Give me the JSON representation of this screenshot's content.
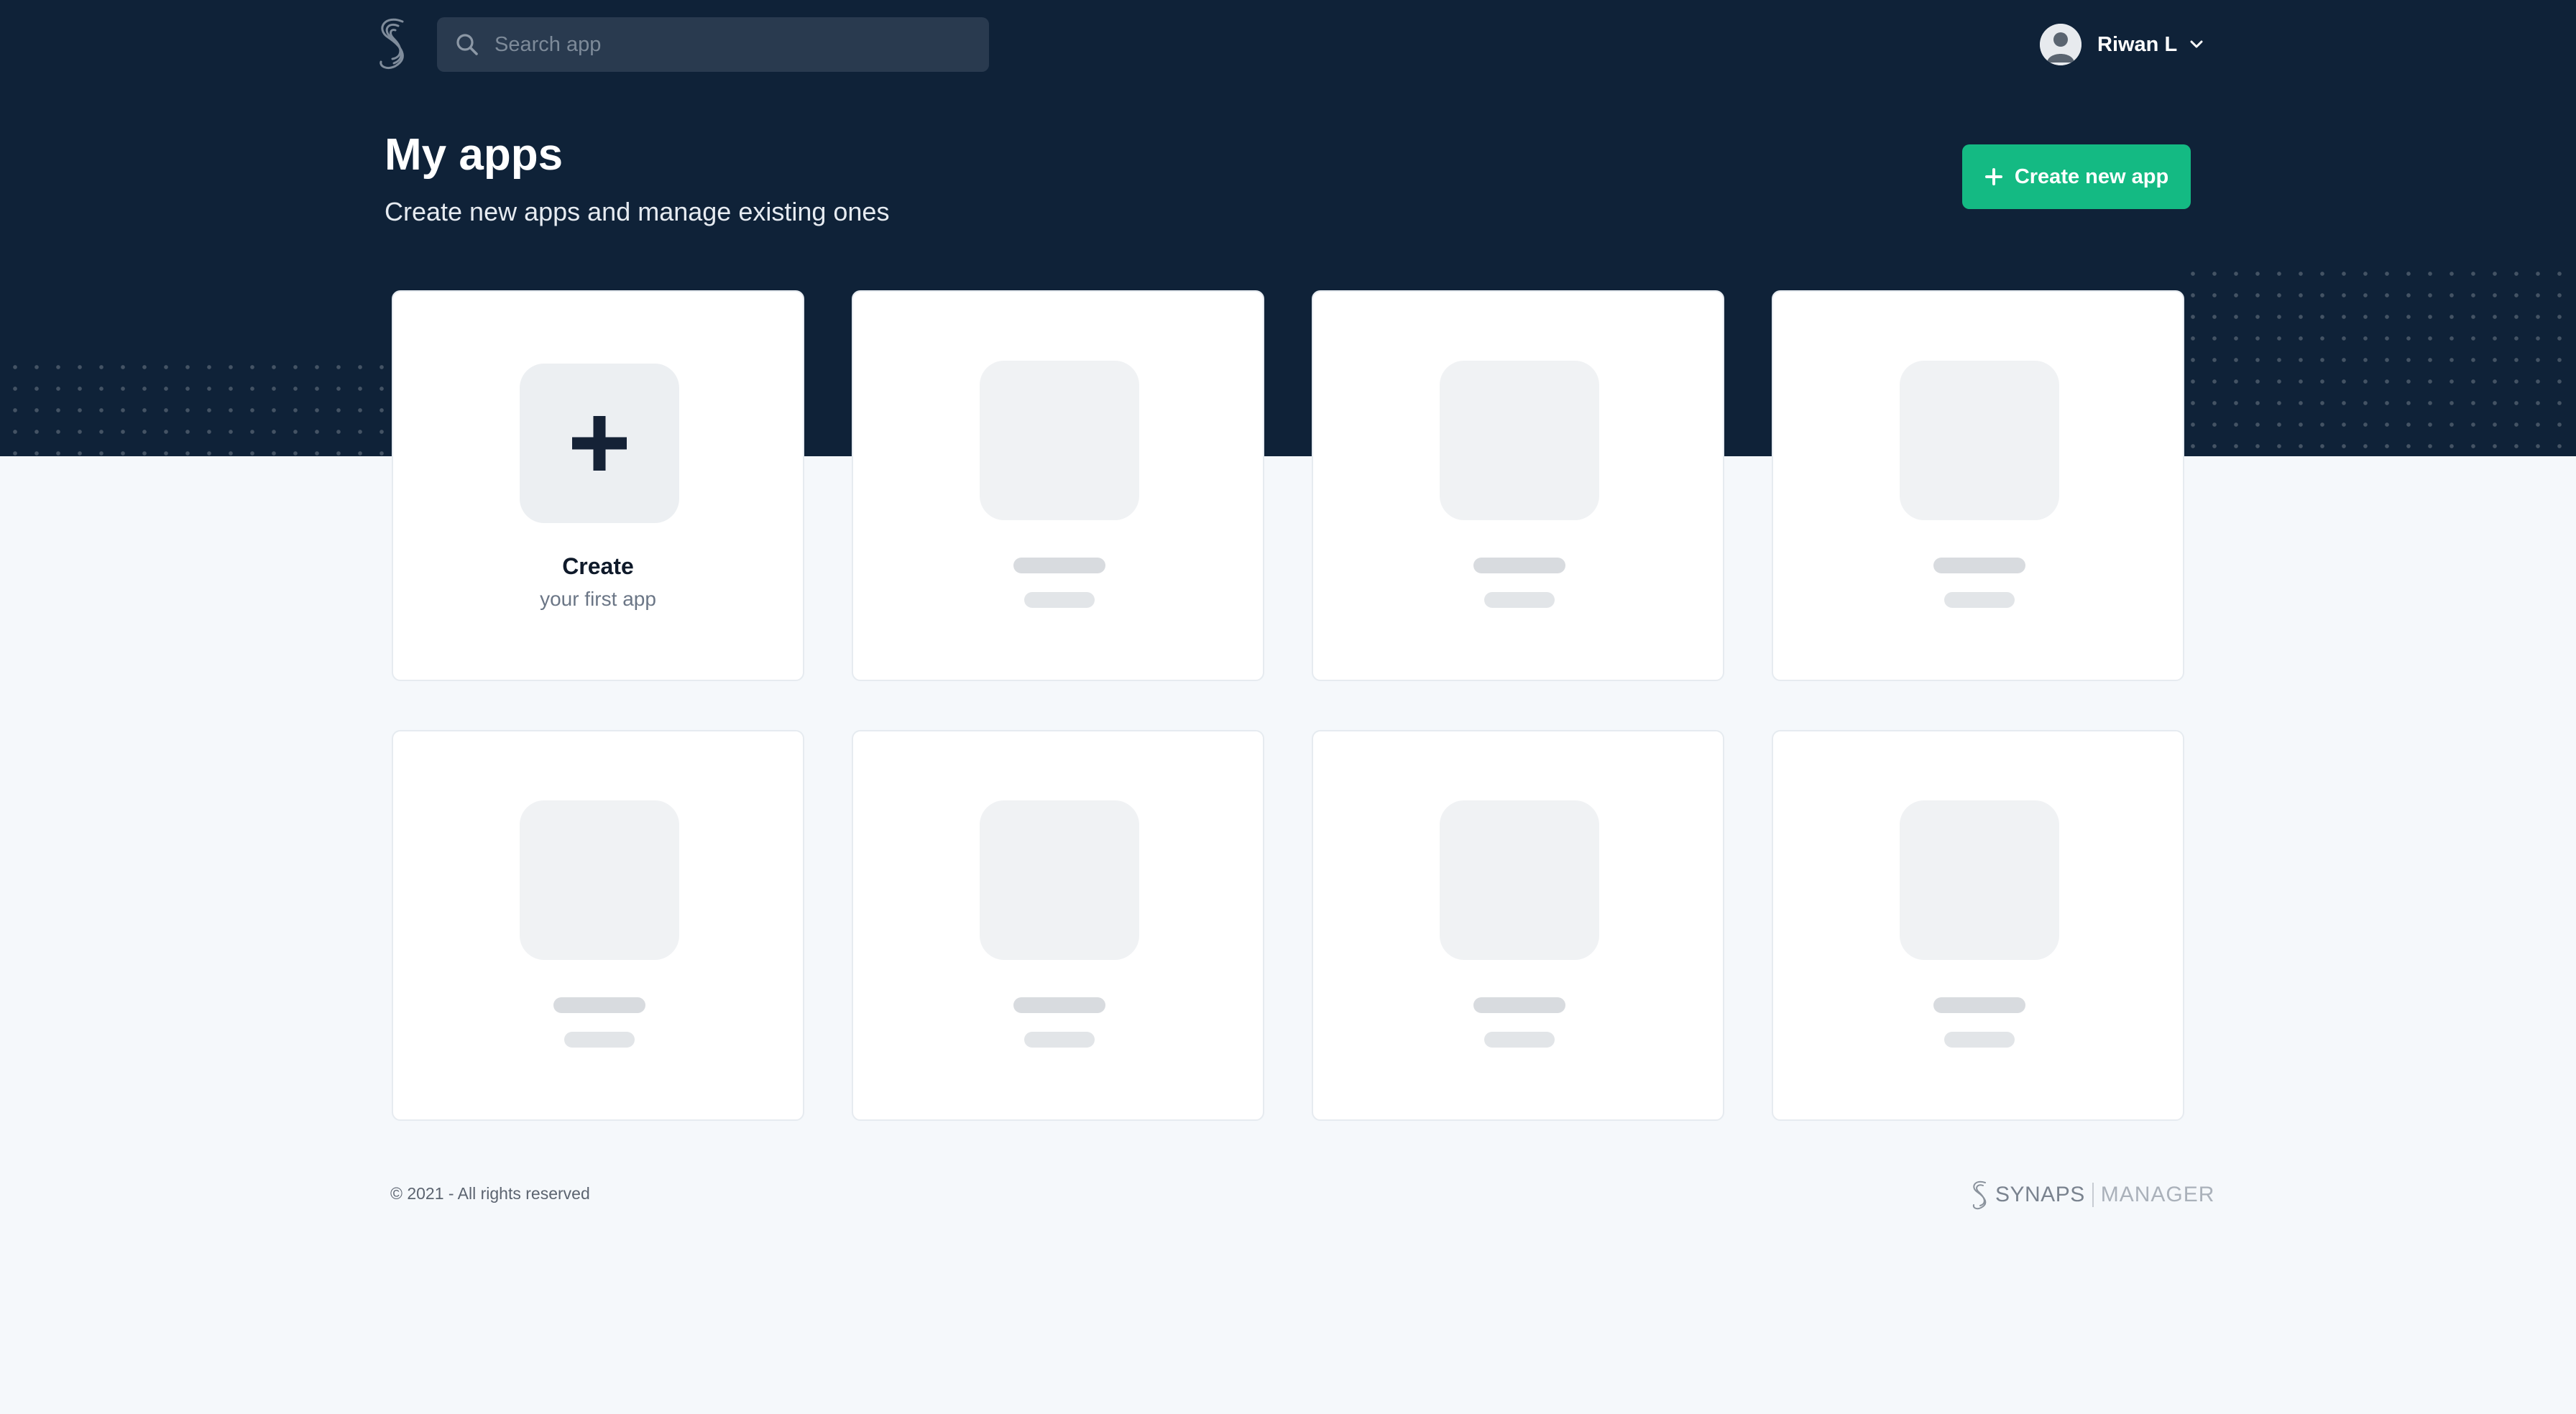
{
  "header": {
    "search_placeholder": "Search app",
    "user_name": "Riwan L"
  },
  "main": {
    "title": "My apps",
    "subtitle": "Create new apps and manage existing ones",
    "create_button_label": "Create new app",
    "create_card": {
      "title": "Create",
      "subtitle": "your first app"
    }
  },
  "footer": {
    "copyright": "© 2021 - All rights reserved",
    "brand_name": "SYNAPS",
    "brand_product": "MANAGER"
  },
  "colors": {
    "hero_background": "#0f2238",
    "page_background": "#f5f8fb",
    "accent": "#14ba83"
  },
  "icons": [
    "logo-icon",
    "search-icon",
    "avatar",
    "chevron-down-icon",
    "plus-icon",
    "synaps-logo-icon"
  ]
}
